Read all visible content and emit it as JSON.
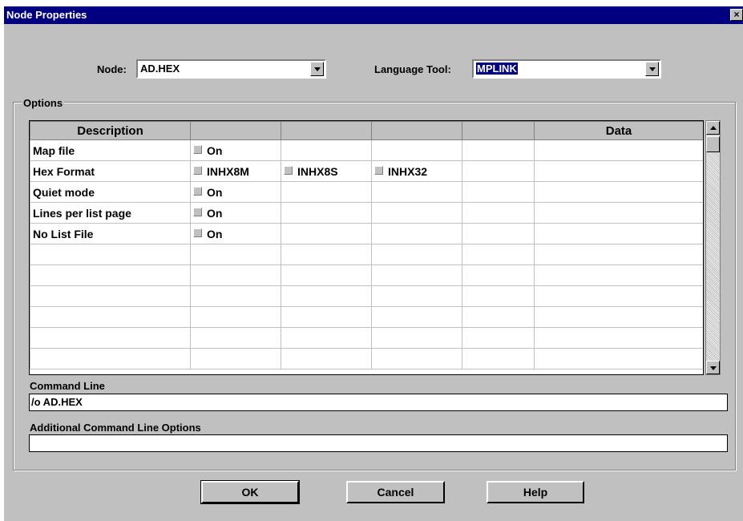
{
  "window": {
    "title": "Node Properties",
    "close_glyph": "×"
  },
  "node": {
    "label": "Node:",
    "value": "AD.HEX"
  },
  "language_tool": {
    "label": "Language Tool:",
    "value": "MPLINK"
  },
  "options": {
    "label": "Options",
    "columns": [
      "Description",
      "",
      "",
      "",
      "",
      "Data"
    ],
    "rows": [
      {
        "description": "Map file",
        "choices": [
          "On"
        ]
      },
      {
        "description": "Hex Format",
        "choices": [
          "INHX8M",
          "INHX8S",
          "INHX32"
        ]
      },
      {
        "description": "Quiet mode",
        "choices": [
          "On"
        ]
      },
      {
        "description": "Lines per list page",
        "choices": [
          "On"
        ]
      },
      {
        "description": "No List File",
        "choices": [
          "On"
        ]
      }
    ]
  },
  "command_line": {
    "label": "Command Line",
    "value": "/o AD.HEX"
  },
  "additional": {
    "label": "Additional Command Line Options",
    "value": ""
  },
  "buttons": {
    "ok": "OK",
    "cancel": "Cancel",
    "help": "Help"
  }
}
